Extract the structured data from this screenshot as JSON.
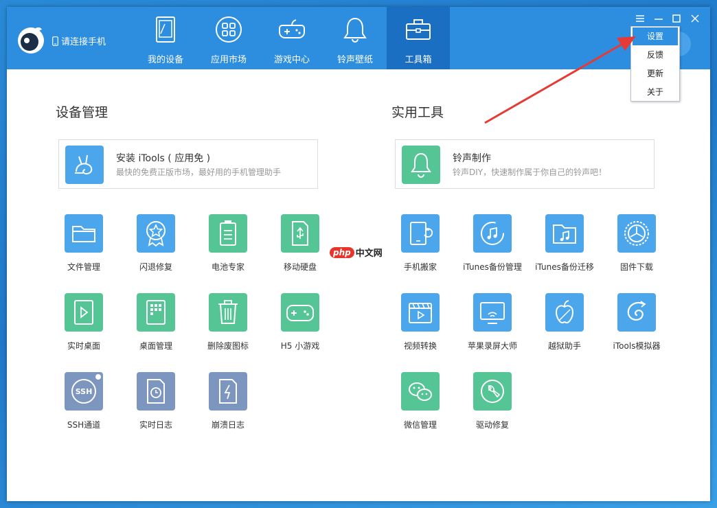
{
  "header": {
    "connect_label": "请连接手机",
    "tabs": [
      {
        "label": "我的设备",
        "icon": "tablet-icon"
      },
      {
        "label": "应用市场",
        "icon": "apps-grid-icon"
      },
      {
        "label": "游戏中心",
        "icon": "gamepad-icon"
      },
      {
        "label": "铃声壁纸",
        "icon": "bell-icon"
      },
      {
        "label": "工具箱",
        "icon": "toolbox-icon",
        "active": true
      }
    ]
  },
  "menu": {
    "items": [
      "设置",
      "反馈",
      "更新",
      "关于"
    ],
    "selected": "设置"
  },
  "device_section": {
    "title": "设备管理",
    "card": {
      "title": "安装 iTools ( 应用免 )",
      "desc": "最快的免费正版市场，最好用的手机管理助手"
    },
    "tools": [
      "文件管理",
      "闪退修复",
      "电池专家",
      "移动硬盘",
      "实时桌面",
      "桌面管理",
      "删除废图标",
      "H5 小游戏",
      "SSH通道",
      "实时日志",
      "崩溃日志"
    ]
  },
  "utility_section": {
    "title": "实用工具",
    "card": {
      "title": "铃声制作",
      "desc": "铃声DIY，快速制作属于你自己的铃声吧！"
    },
    "tools": [
      "手机搬家",
      "iTunes备份管理",
      "iTunes备份迁移",
      "固件下载",
      "视频转换",
      "苹果录屏大师",
      "越狱助手",
      "iTools模拟器",
      "微信管理",
      "驱动修复"
    ]
  },
  "watermark": {
    "pill": "php",
    "text": "中文网"
  },
  "colors": {
    "accent": "#2d8ee0",
    "active_tab": "#1b6fc2",
    "blue_tile": "#4ba6ec",
    "green_tile": "#56c596",
    "slate_tile": "#7c96c0",
    "arrow": "#e53a36"
  }
}
